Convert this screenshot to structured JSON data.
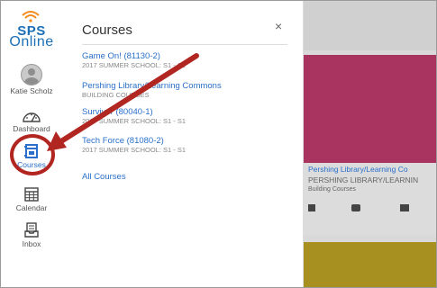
{
  "logo": {
    "line1": "SPS",
    "line2": "Online"
  },
  "nav": {
    "account": "Katie Scholz",
    "dashboard": "Dashboard",
    "courses": "Courses",
    "calendar": "Calendar",
    "inbox": "Inbox"
  },
  "tray": {
    "title": "Courses",
    "close": "×",
    "courses": [
      {
        "name": "Game On! (81130-2)",
        "term": "2017 SUMMER SCHOOL: S1 - S1"
      },
      {
        "name": "Pershing Library/Learning Commons",
        "term": "BUILDING COURSES"
      },
      {
        "name": "Survivor (80040-1)",
        "term": "2017 SUMMER SCHOOL: S1 - S1"
      },
      {
        "name": "Tech Force (81080-2)",
        "term": "2017 SUMMER SCHOOL: S1 - S1"
      }
    ],
    "all_courses": "All Courses"
  },
  "card": {
    "title": "Pershing Library/Learning Co",
    "subtitle": "PERSHING LIBRARY/LEARNIN",
    "term": "Building Courses",
    "color": "#a8345f"
  },
  "colors": {
    "accent": "#2a6fc9",
    "annotation": "#b22621",
    "brand": "#1c6fb5",
    "wifi": "#f28a1c"
  }
}
